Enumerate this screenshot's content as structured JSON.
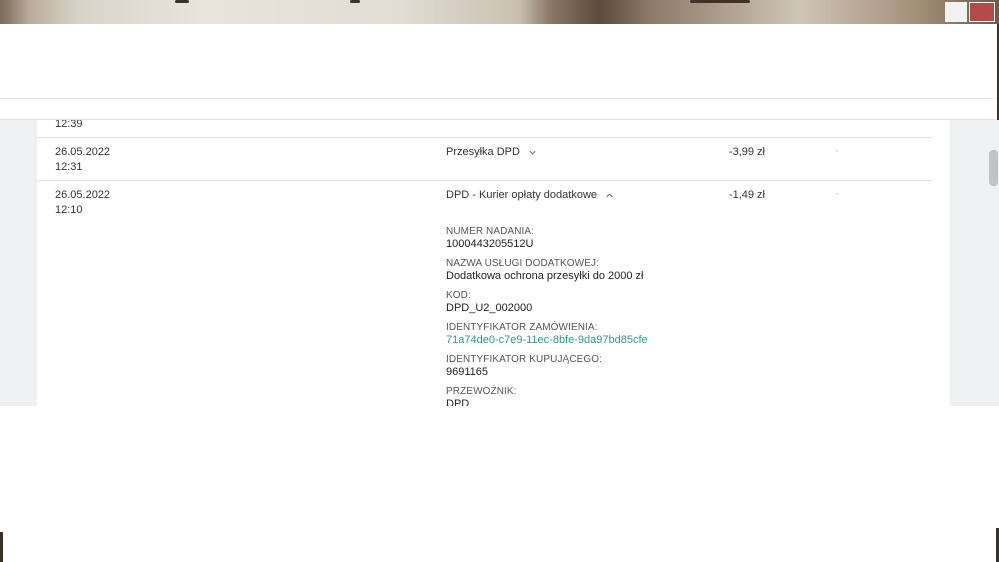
{
  "rows": [
    {
      "date": "",
      "time": "12:39",
      "description": "",
      "amount": ""
    },
    {
      "date": "26.05.2022",
      "time": "12:31",
      "description": "Przesyłka DPD",
      "amount": "-3,99 zł",
      "dot": "·"
    },
    {
      "date": "26.05.2022",
      "time": "12:10",
      "description": "DPD - Kurier opłaty dodatkowe",
      "amount": "-1,49 zł",
      "dot": "·"
    }
  ],
  "details": [
    {
      "label": "NUMER NADANIA:",
      "value": "1000443205512U",
      "link": false
    },
    {
      "label": "NAZWA USŁUGI DODATKOWEJ:",
      "value": "Dodatkowa ochrona przesyłki do 2000 zł",
      "link": false
    },
    {
      "label": "KOD:",
      "value": "DPD_U2_002000",
      "link": false
    },
    {
      "label": "IDENTYFIKATOR ZAMÓWIENIA:",
      "value": "71a74de0-c7e9-11ec-8bfe-9da97bd85cfe",
      "link": true
    },
    {
      "label": "IDENTYFIKATOR KUPUJĄCEGO:",
      "value": "9691165",
      "link": false
    },
    {
      "label": "PRZEWOŹNIK:",
      "value": "DPD",
      "link": false
    }
  ],
  "colors": {
    "accent_link": "#2a9b8d",
    "page_bg": "#eef0f2"
  },
  "icons": {
    "collapsed": "chevron-down-icon",
    "expanded": "chevron-up-icon"
  }
}
